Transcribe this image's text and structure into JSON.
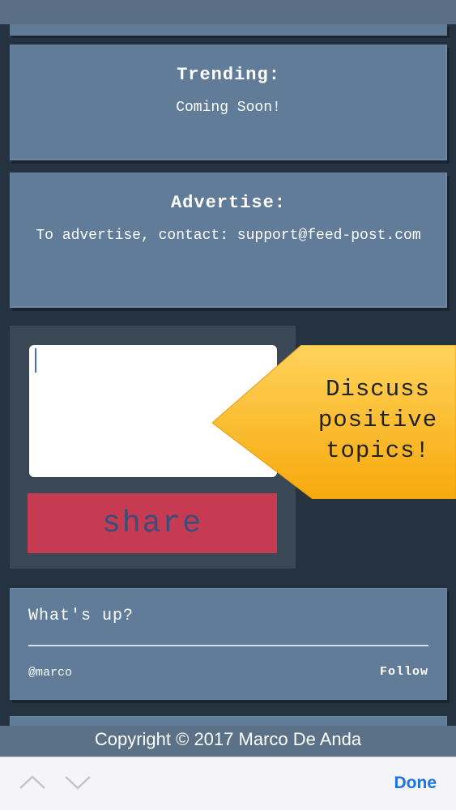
{
  "trending": {
    "title": "Trending:",
    "text": "Coming Soon!"
  },
  "advertise": {
    "title": "Advertise:",
    "text": "To advertise, contact: support@feed-post.com"
  },
  "composer": {
    "input_value": "",
    "share_label": "share"
  },
  "callout": {
    "text": "Discuss positive topics!",
    "color": "#fbb917"
  },
  "post": {
    "prompt": "What's up?",
    "user": "@marco",
    "follow_label": "Follow"
  },
  "footer": {
    "copyright": "Copyright © 2017 Marco De Anda"
  },
  "keyboard_toolbar": {
    "done_label": "Done",
    "prev_icon": "chevron-up-icon",
    "next_icon": "chevron-down-icon"
  },
  "colors": {
    "background": "#25323f",
    "card": "#617c98",
    "share_button": "#c63a52",
    "accent_blue": "#1a73e8"
  }
}
